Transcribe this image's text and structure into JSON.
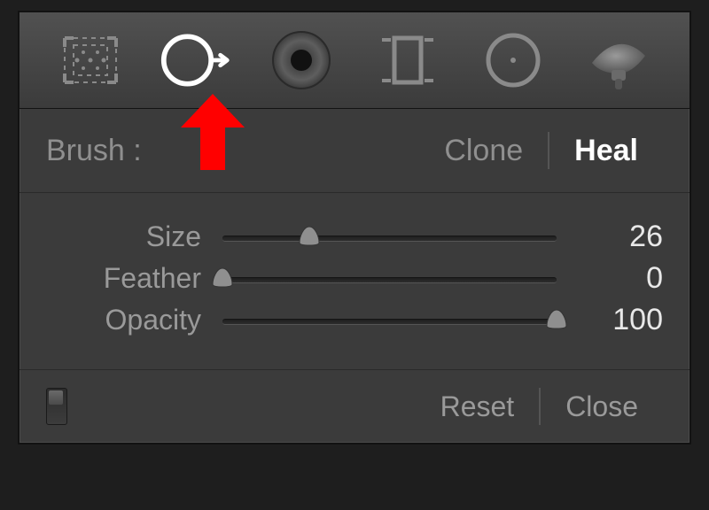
{
  "toolbar": {
    "tools": [
      {
        "name": "crop-tool"
      },
      {
        "name": "spot-removal-tool"
      },
      {
        "name": "red-eye-tool"
      },
      {
        "name": "graduated-filter-tool"
      },
      {
        "name": "radial-filter-tool"
      },
      {
        "name": "adjustment-brush-tool"
      }
    ],
    "selected_index": 1
  },
  "brush_header": {
    "label": "Brush :",
    "mode_clone": "Clone",
    "mode_heal": "Heal",
    "selected_mode": "Heal"
  },
  "sliders": {
    "size": {
      "label": "Size",
      "value": 26,
      "min": 0,
      "max": 100
    },
    "feather": {
      "label": "Feather",
      "value": 0,
      "min": 0,
      "max": 100
    },
    "opacity": {
      "label": "Opacity",
      "value": 100,
      "min": 0,
      "max": 100
    }
  },
  "footer": {
    "reset": "Reset",
    "close": "Close"
  },
  "annotation": {
    "arrow_target": "spot-removal-tool"
  },
  "colors": {
    "annotation_arrow": "#FF0000"
  }
}
